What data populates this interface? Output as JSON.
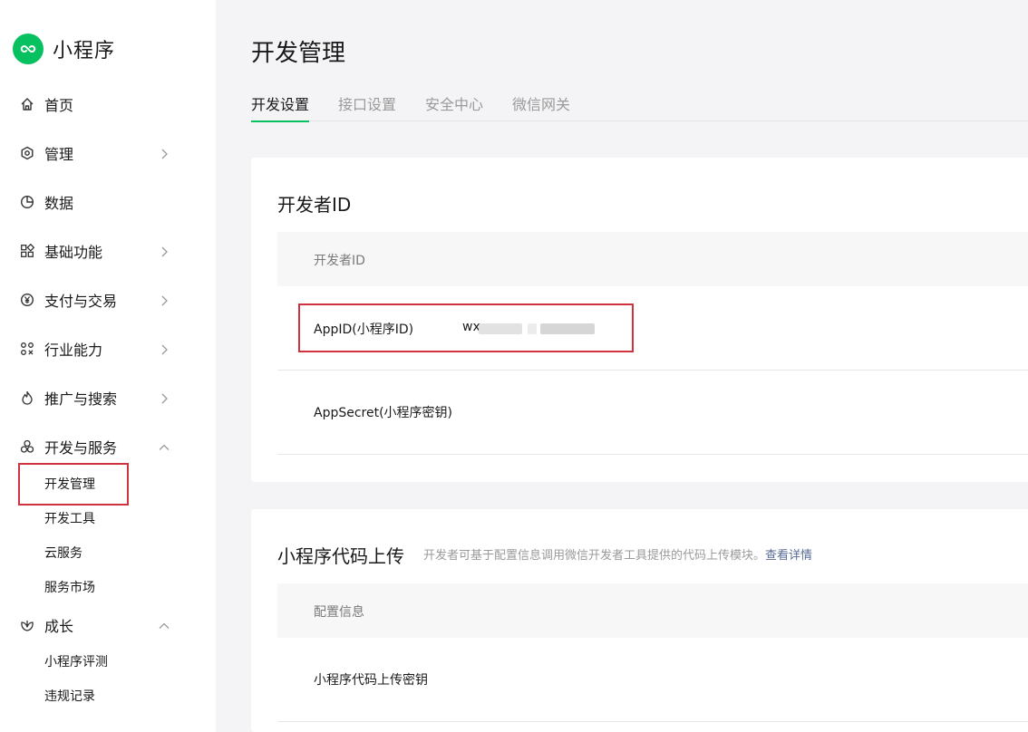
{
  "brand": {
    "title": "小程序",
    "logo_icon": "mini-program-logo-icon",
    "color": "#07c160"
  },
  "sidebar": {
    "items": [
      {
        "label": "首页",
        "icon": "home-icon"
      },
      {
        "label": "管理",
        "icon": "hexagon-icon",
        "chevron": "right"
      },
      {
        "label": "数据",
        "icon": "pie-chart-icon"
      },
      {
        "label": "基础功能",
        "icon": "grid-icon",
        "chevron": "right"
      },
      {
        "label": "支付与交易",
        "icon": "yen-icon",
        "chevron": "right"
      },
      {
        "label": "行业能力",
        "icon": "industry-icon",
        "chevron": "right"
      },
      {
        "label": "推广与搜索",
        "icon": "flame-icon",
        "chevron": "right"
      },
      {
        "label": "开发与服务",
        "icon": "dev-service-icon",
        "chevron": "up"
      }
    ],
    "dev_sub": [
      "开发管理",
      "开发工具",
      "云服务",
      "服务市场"
    ],
    "growth": {
      "label": "成长",
      "icon": "growth-icon",
      "chevron": "up"
    },
    "growth_sub": [
      "小程序评测",
      "违规记录"
    ]
  },
  "page": {
    "title": "开发管理",
    "tabs": [
      {
        "label": "开发设置",
        "active": true
      },
      {
        "label": "接口设置",
        "active": false
      },
      {
        "label": "安全中心",
        "active": false
      },
      {
        "label": "微信网关",
        "active": false
      }
    ]
  },
  "dev_id_card": {
    "title": "开发者ID",
    "table_header": "开发者ID",
    "rows": [
      {
        "key": "AppID(小程序ID)",
        "value": "wx"
      },
      {
        "key": "AppSecret(小程序密钥)",
        "value": ""
      }
    ]
  },
  "upload_card": {
    "title": "小程序代码上传",
    "desc": "开发者可基于配置信息调用微信开发者工具提供的代码上传模块。",
    "desc_link": "查看详情",
    "table_header": "配置信息",
    "rows": [
      {
        "key": "小程序代码上传密钥"
      }
    ]
  },
  "colors": {
    "accent": "#07c160",
    "highlight": "#d0333d",
    "link": "#576b95"
  }
}
